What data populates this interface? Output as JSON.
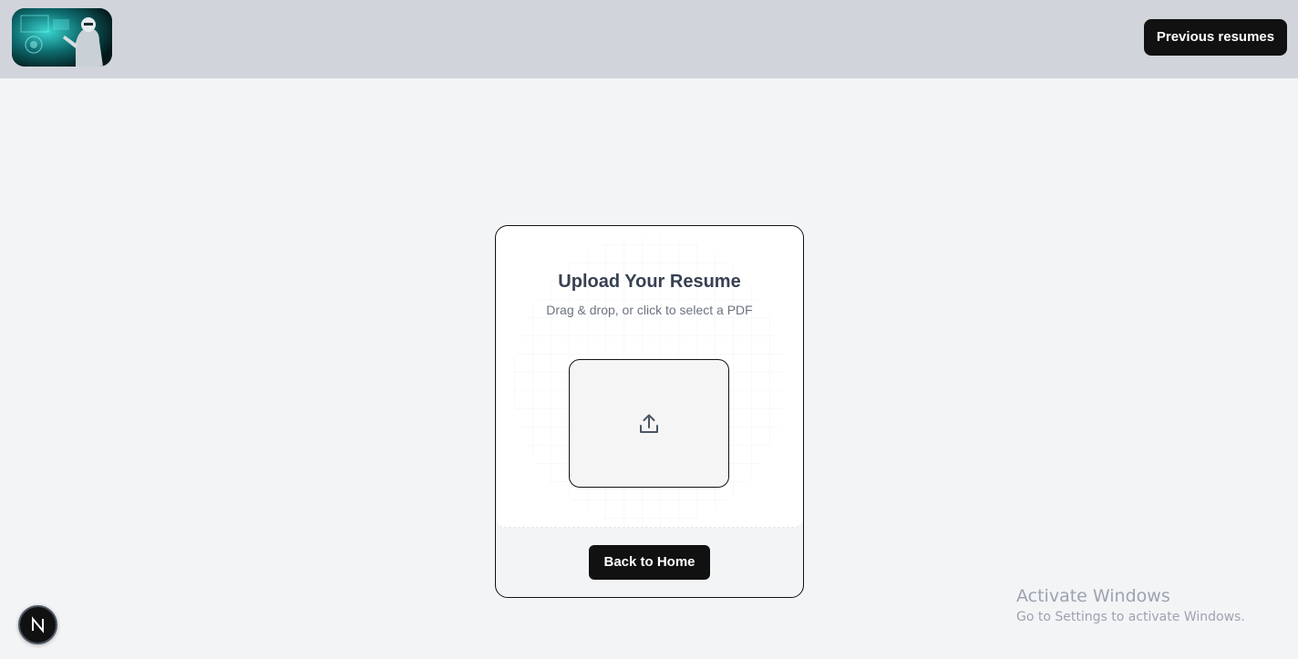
{
  "header": {
    "logo_icon": "robot-logo-icon",
    "previous_resumes_label": "Previous resumes"
  },
  "upload_card": {
    "title": "Upload Your Resume",
    "subtitle": "Drag & drop, or click to select a PDF",
    "upload_icon": "upload-icon",
    "back_label": "Back to Home"
  },
  "dev_badge": {
    "icon": "nextjs-icon",
    "letter": "N"
  },
  "os_watermark": {
    "title": "Activate Windows",
    "subtitle": "Go to Settings to activate Windows."
  },
  "colors": {
    "header_bg": "#d1d5db",
    "page_bg": "#f3f4f6",
    "button_bg": "#111111",
    "button_text": "#ffffff"
  }
}
